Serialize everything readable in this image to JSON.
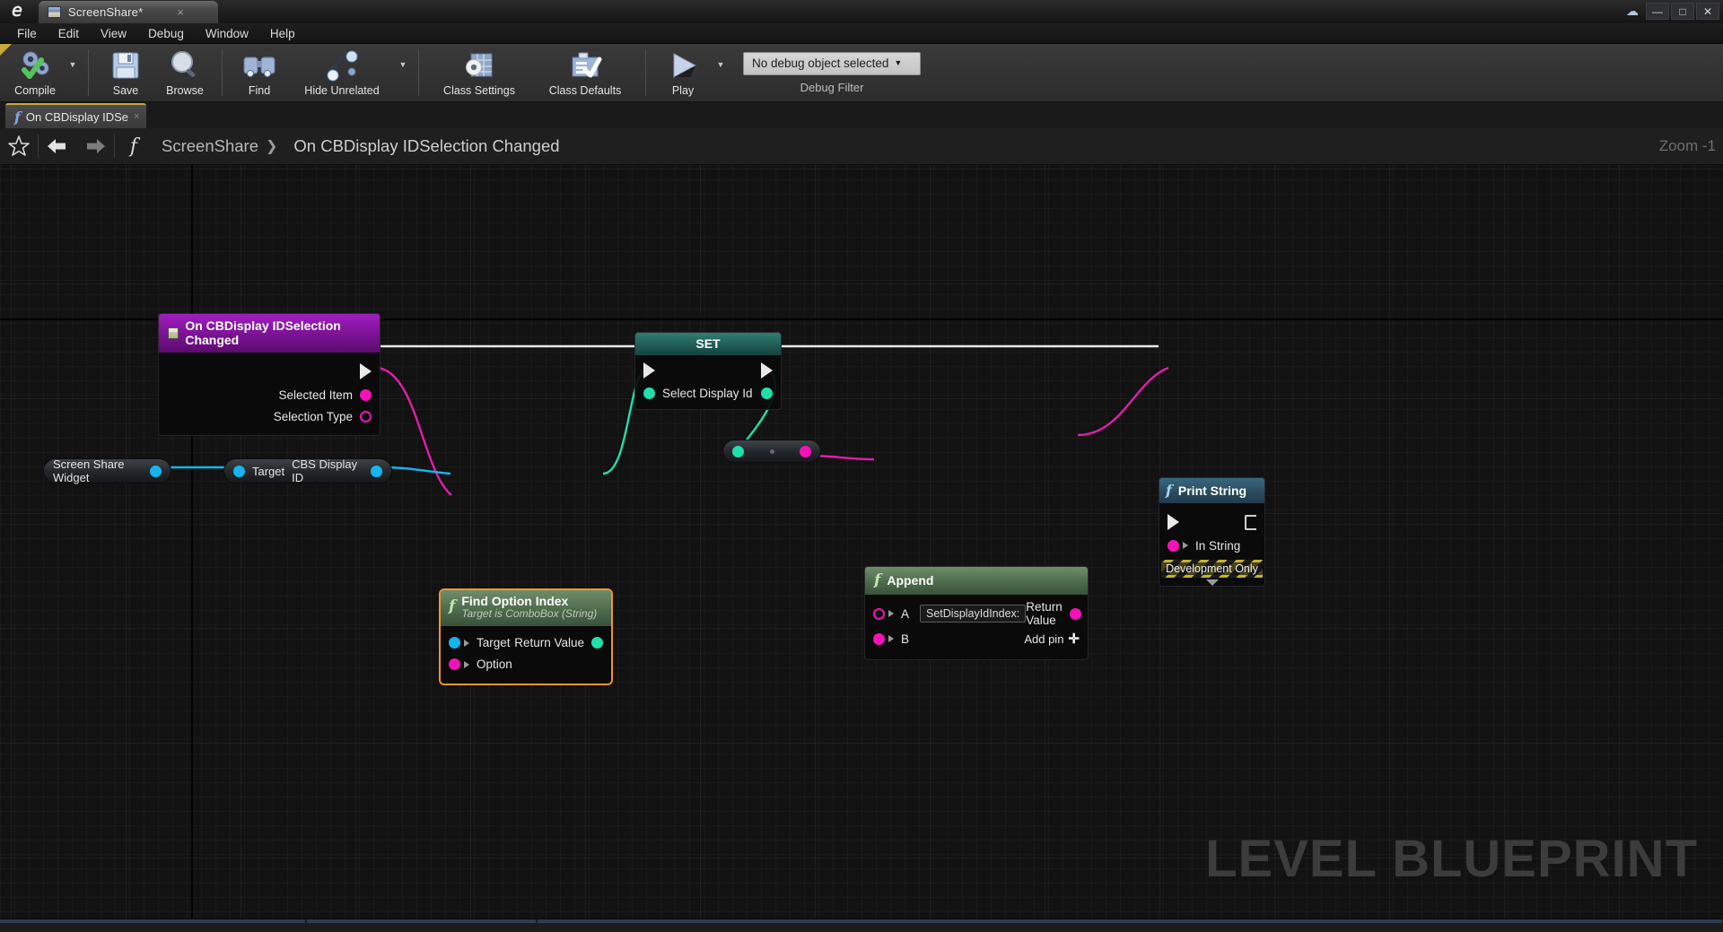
{
  "window": {
    "app_logo": "unreal-engine-logo",
    "tab_title": "ScreenShare*",
    "tab_close": "×",
    "cloud_icon": "cloud-icon",
    "minimize": "—",
    "maximize": "□",
    "close": "✕"
  },
  "menubar": {
    "items": [
      "File",
      "Edit",
      "View",
      "Debug",
      "Window",
      "Help"
    ]
  },
  "toolbar": {
    "compile": "Compile",
    "save": "Save",
    "browse": "Browse",
    "find": "Find",
    "hide_unrelated": "Hide Unrelated",
    "class_settings": "Class Settings",
    "class_defaults": "Class Defaults",
    "play": "Play",
    "debug_object": "No debug object selected",
    "debug_caret": "▼",
    "debug_filter_label": "Debug Filter",
    "caret": "▼"
  },
  "function_tab": {
    "label": "On CBDisplay IDSe",
    "close": "×",
    "glyph": "f"
  },
  "breadcrumb": {
    "favorite_icon": "star-icon",
    "back_icon": "back-arrow-icon",
    "forward_icon": "forward-arrow-icon",
    "function_icon": "function-icon",
    "root": "ScreenShare",
    "separator": "❯",
    "current": "On CBDisplay IDSelection Changed",
    "zoom": "Zoom -1"
  },
  "graph": {
    "watermark": "LEVEL BLUEPRINT",
    "nodes": {
      "event": {
        "title": "On CBDisplay IDSelection Changed",
        "icon": "event-node-icon",
        "outputs": [
          "Selected Item",
          "Selection Type"
        ]
      },
      "set": {
        "title": "SET",
        "pin": "Select Display Id"
      },
      "find_option_index": {
        "title": "Find Option Index",
        "subtitle": "Target is ComboBox (String)",
        "glyph": "f",
        "inputs": [
          "Target",
          "Option"
        ],
        "outputs": [
          "Return Value"
        ]
      },
      "append": {
        "title": "Append",
        "glyph": "f",
        "input_a_label": "A",
        "input_a_value": "SetDisplayIdIndex:",
        "input_b_label": "B",
        "output": "Return Value",
        "add_pin": "Add pin",
        "add_pin_glyph": "✛"
      },
      "print_string": {
        "title": "Print String",
        "glyph": "f",
        "input": "In String",
        "dev_only": "Development Only",
        "collapse": "collapse-arrow-icon"
      },
      "widget_pill": {
        "label": "Screen Share Widget"
      },
      "cbs_pill": {
        "target": "Target",
        "label": "CBS Display ID"
      },
      "reroute_pill": {
        "label": ""
      }
    }
  },
  "colors": {
    "exec_white": "#e8e8e8",
    "string_magenta": "#f312b8",
    "object_cyan": "#16b4f0",
    "int_green": "#1fe0a8",
    "event_purple": "#7a1292",
    "selected_orange": "#f0962a",
    "function_green": "#4e6b4c",
    "print_blue": "#2a4c60"
  }
}
